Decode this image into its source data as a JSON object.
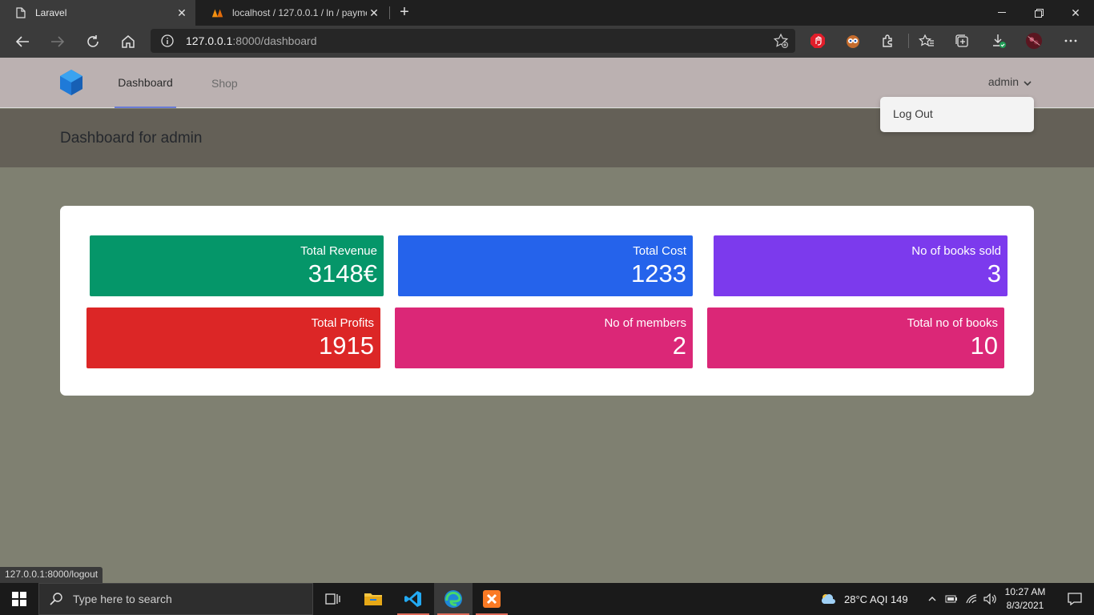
{
  "browser": {
    "tabs": [
      {
        "title": "Laravel",
        "active": true
      },
      {
        "title": "localhost / 127.0.0.1 / ln / payme",
        "active": false
      }
    ],
    "address": {
      "host": "127.0.0.1",
      "rest": ":8000/dashboard"
    },
    "status_url": "127.0.0.1:8000/logout"
  },
  "nav": {
    "links": [
      "Dashboard",
      "Shop"
    ],
    "user": "admin"
  },
  "dropdown": {
    "logout": "Log Out"
  },
  "header": {
    "title": "Dashboard for admin"
  },
  "stats": [
    {
      "label": "Total Revenue",
      "value": "3148€",
      "color": "#059669"
    },
    {
      "label": "Total Cost",
      "value": "1233",
      "color": "#2563eb"
    },
    {
      "label": "No of books sold",
      "value": "3",
      "color": "#7c3aed"
    },
    {
      "label": "Total Profits",
      "value": "1915",
      "color": "#dc2626"
    },
    {
      "label": "No of members",
      "value": "2",
      "color": "#db2777"
    },
    {
      "label": "Total no of books",
      "value": "10",
      "color": "#db2777"
    }
  ],
  "taskbar": {
    "search_placeholder": "Type here to search",
    "weather": "28°C  AQI 149",
    "time": "10:27 AM",
    "date": "8/3/2021"
  }
}
